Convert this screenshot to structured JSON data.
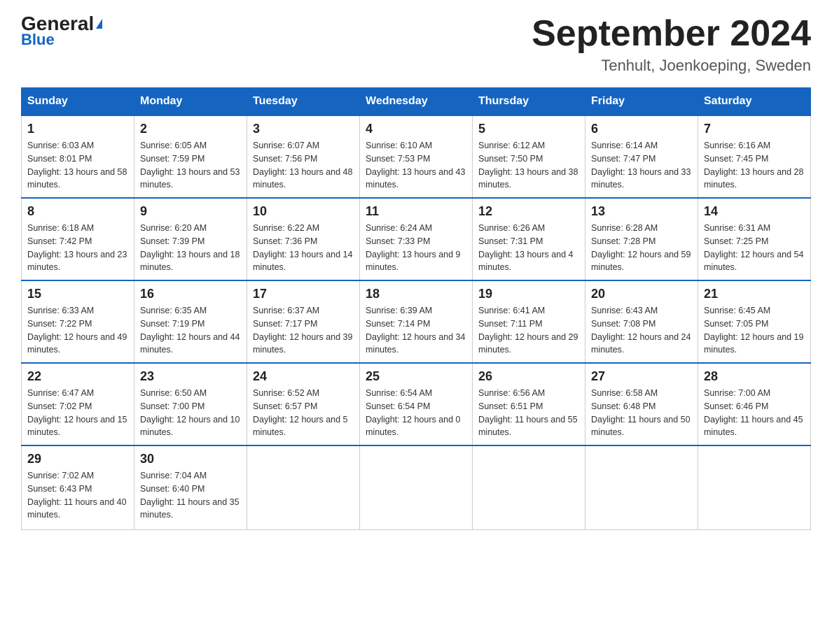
{
  "header": {
    "logo_main": "General",
    "logo_sub": "Blue",
    "month_title": "September 2024",
    "location": "Tenhult, Joenkoeping, Sweden"
  },
  "days_of_week": [
    "Sunday",
    "Monday",
    "Tuesday",
    "Wednesday",
    "Thursday",
    "Friday",
    "Saturday"
  ],
  "weeks": [
    [
      {
        "day": "1",
        "sunrise": "6:03 AM",
        "sunset": "8:01 PM",
        "daylight": "13 hours and 58 minutes."
      },
      {
        "day": "2",
        "sunrise": "6:05 AM",
        "sunset": "7:59 PM",
        "daylight": "13 hours and 53 minutes."
      },
      {
        "day": "3",
        "sunrise": "6:07 AM",
        "sunset": "7:56 PM",
        "daylight": "13 hours and 48 minutes."
      },
      {
        "day": "4",
        "sunrise": "6:10 AM",
        "sunset": "7:53 PM",
        "daylight": "13 hours and 43 minutes."
      },
      {
        "day": "5",
        "sunrise": "6:12 AM",
        "sunset": "7:50 PM",
        "daylight": "13 hours and 38 minutes."
      },
      {
        "day": "6",
        "sunrise": "6:14 AM",
        "sunset": "7:47 PM",
        "daylight": "13 hours and 33 minutes."
      },
      {
        "day": "7",
        "sunrise": "6:16 AM",
        "sunset": "7:45 PM",
        "daylight": "13 hours and 28 minutes."
      }
    ],
    [
      {
        "day": "8",
        "sunrise": "6:18 AM",
        "sunset": "7:42 PM",
        "daylight": "13 hours and 23 minutes."
      },
      {
        "day": "9",
        "sunrise": "6:20 AM",
        "sunset": "7:39 PM",
        "daylight": "13 hours and 18 minutes."
      },
      {
        "day": "10",
        "sunrise": "6:22 AM",
        "sunset": "7:36 PM",
        "daylight": "13 hours and 14 minutes."
      },
      {
        "day": "11",
        "sunrise": "6:24 AM",
        "sunset": "7:33 PM",
        "daylight": "13 hours and 9 minutes."
      },
      {
        "day": "12",
        "sunrise": "6:26 AM",
        "sunset": "7:31 PM",
        "daylight": "13 hours and 4 minutes."
      },
      {
        "day": "13",
        "sunrise": "6:28 AM",
        "sunset": "7:28 PM",
        "daylight": "12 hours and 59 minutes."
      },
      {
        "day": "14",
        "sunrise": "6:31 AM",
        "sunset": "7:25 PM",
        "daylight": "12 hours and 54 minutes."
      }
    ],
    [
      {
        "day": "15",
        "sunrise": "6:33 AM",
        "sunset": "7:22 PM",
        "daylight": "12 hours and 49 minutes."
      },
      {
        "day": "16",
        "sunrise": "6:35 AM",
        "sunset": "7:19 PM",
        "daylight": "12 hours and 44 minutes."
      },
      {
        "day": "17",
        "sunrise": "6:37 AM",
        "sunset": "7:17 PM",
        "daylight": "12 hours and 39 minutes."
      },
      {
        "day": "18",
        "sunrise": "6:39 AM",
        "sunset": "7:14 PM",
        "daylight": "12 hours and 34 minutes."
      },
      {
        "day": "19",
        "sunrise": "6:41 AM",
        "sunset": "7:11 PM",
        "daylight": "12 hours and 29 minutes."
      },
      {
        "day": "20",
        "sunrise": "6:43 AM",
        "sunset": "7:08 PM",
        "daylight": "12 hours and 24 minutes."
      },
      {
        "day": "21",
        "sunrise": "6:45 AM",
        "sunset": "7:05 PM",
        "daylight": "12 hours and 19 minutes."
      }
    ],
    [
      {
        "day": "22",
        "sunrise": "6:47 AM",
        "sunset": "7:02 PM",
        "daylight": "12 hours and 15 minutes."
      },
      {
        "day": "23",
        "sunrise": "6:50 AM",
        "sunset": "7:00 PM",
        "daylight": "12 hours and 10 minutes."
      },
      {
        "day": "24",
        "sunrise": "6:52 AM",
        "sunset": "6:57 PM",
        "daylight": "12 hours and 5 minutes."
      },
      {
        "day": "25",
        "sunrise": "6:54 AM",
        "sunset": "6:54 PM",
        "daylight": "12 hours and 0 minutes."
      },
      {
        "day": "26",
        "sunrise": "6:56 AM",
        "sunset": "6:51 PM",
        "daylight": "11 hours and 55 minutes."
      },
      {
        "day": "27",
        "sunrise": "6:58 AM",
        "sunset": "6:48 PM",
        "daylight": "11 hours and 50 minutes."
      },
      {
        "day": "28",
        "sunrise": "7:00 AM",
        "sunset": "6:46 PM",
        "daylight": "11 hours and 45 minutes."
      }
    ],
    [
      {
        "day": "29",
        "sunrise": "7:02 AM",
        "sunset": "6:43 PM",
        "daylight": "11 hours and 40 minutes."
      },
      {
        "day": "30",
        "sunrise": "7:04 AM",
        "sunset": "6:40 PM",
        "daylight": "11 hours and 35 minutes."
      },
      null,
      null,
      null,
      null,
      null
    ]
  ]
}
